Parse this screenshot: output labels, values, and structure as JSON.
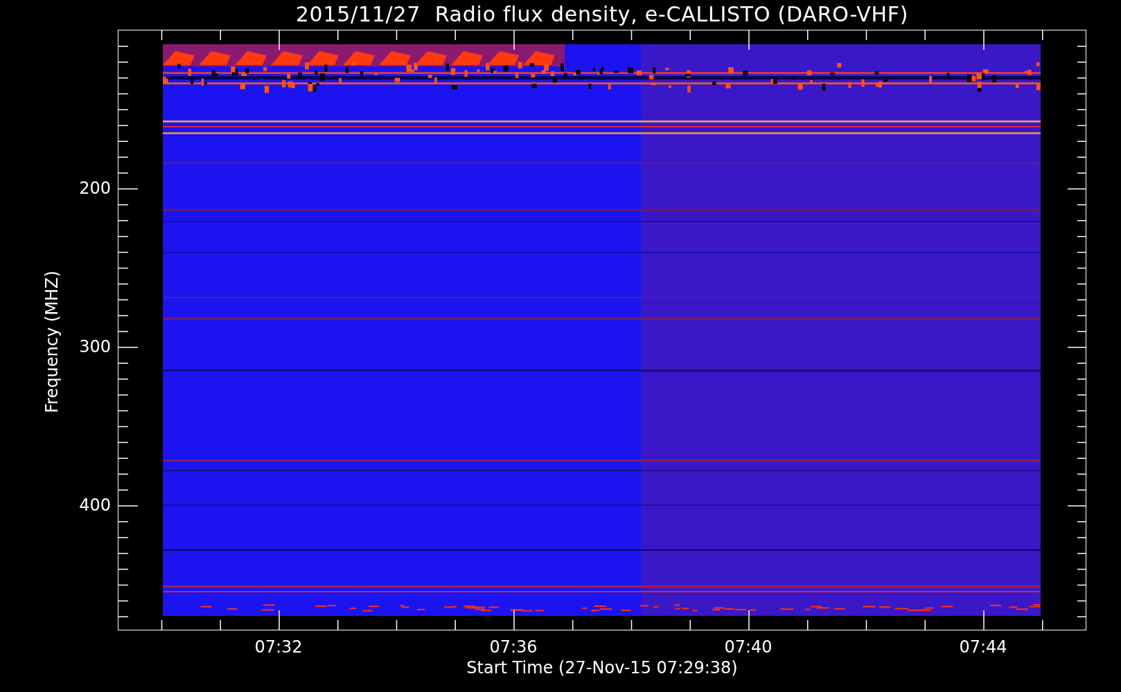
{
  "title": "2015/11/27  Radio flux density, e-CALLISTO (DARO-VHF)",
  "y_axis": {
    "title": "Frequency (MHZ)",
    "ticks": [
      "200",
      "300",
      "400"
    ]
  },
  "x_axis": {
    "title": "Start Time (27-Nov-15 07:29:38)",
    "ticks": [
      "07:32",
      "07:36",
      "07:40",
      "07:44"
    ]
  }
}
